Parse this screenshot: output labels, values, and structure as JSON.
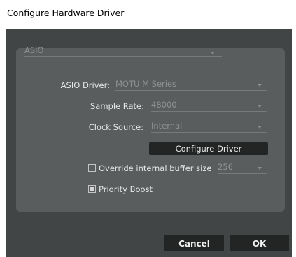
{
  "window": {
    "title": "Configure Hardware Driver"
  },
  "driver_type": {
    "value": "ASIO"
  },
  "asio_driver": {
    "label": "ASIO Driver:",
    "value": "MOTU M Series"
  },
  "sample_rate": {
    "label": "Sample Rate:",
    "value": "48000"
  },
  "clock_source": {
    "label": "Clock Source:",
    "value": "Internal"
  },
  "configure_driver_label": "Configure Driver",
  "override_buffer": {
    "label": "Override internal buffer size",
    "checked": false,
    "value": "256"
  },
  "priority_boost": {
    "label": "Priority Boost",
    "checked": true
  },
  "footer": {
    "cancel_label": "Cancel",
    "ok_label": "OK"
  },
  "icons": {
    "dropdown": "chevron-down-icon"
  },
  "colors": {
    "dialog_background": "#424545",
    "panel_background": "#5a5d5d",
    "button_background": "#232525",
    "text_primary": "#e6e6e6",
    "text_muted": "#8f9292"
  }
}
